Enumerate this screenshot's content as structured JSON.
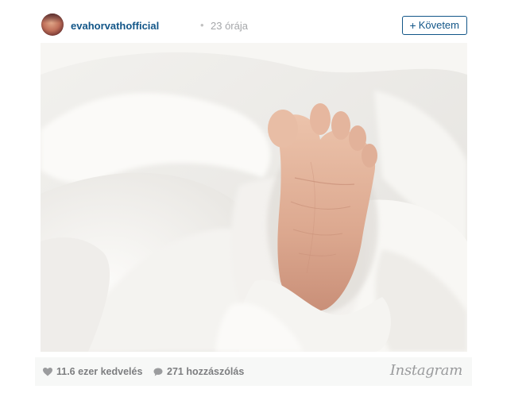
{
  "post": {
    "username": "evahorvathofficial",
    "separator": "•",
    "time": "23 órája",
    "follow_label": "Követem",
    "follow_plus": "+"
  },
  "footer": {
    "likes": "11.6 ezer kedvelés",
    "comments": "271 hozzászólás",
    "brand": "Instagram"
  },
  "icons": {
    "like": "heart-icon",
    "comment": "speech-bubble-icon"
  },
  "colors": {
    "username": "#125688",
    "muted": "#a5a7aa",
    "footer_bg": "#f7f8f7"
  }
}
